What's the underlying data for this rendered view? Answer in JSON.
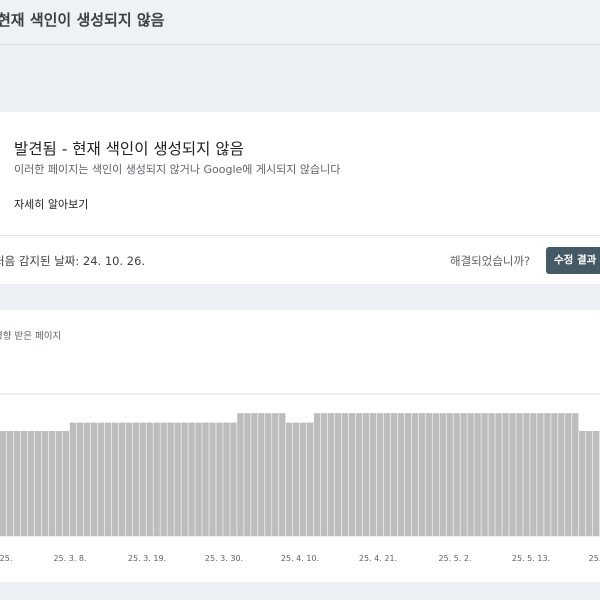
{
  "header": {
    "title": "현재 색인이 생성되지 않음"
  },
  "issue": {
    "title": "발견됨 - 현재 색인이 생성되지 않음",
    "description": "이러한 페이지는 색인이 생성되지 않거나 Google에 게시되지 않습니다",
    "learn_more": "자세히 알아보기",
    "first_detected": "처음 감지된 날짜: 24. 10. 26.",
    "resolved_question": "해결되었습니까?",
    "validate_button": "수정 결과 확인"
  },
  "chart_card": {
    "label": "영향 받은 페이지"
  },
  "chart_data": {
    "type": "bar",
    "series_color": "#bdbdbd",
    "x_tick_labels": [
      "25.",
      "25. 3. 8.",
      "25. 3. 19.",
      "25. 3. 30.",
      "25. 4. 10.",
      "25. 4. 21.",
      "25. 5. 2.",
      "25. 5. 13.",
      "25."
    ],
    "gridlines": true,
    "runs": [
      {
        "count": 10,
        "level": 1.0
      },
      {
        "count": 24,
        "level": 1.08
      },
      {
        "count": 7,
        "level": 1.17
      },
      {
        "count": 4,
        "level": 1.08
      },
      {
        "count": 38,
        "level": 1.17
      },
      {
        "count": 3,
        "level": 1.0
      }
    ]
  }
}
